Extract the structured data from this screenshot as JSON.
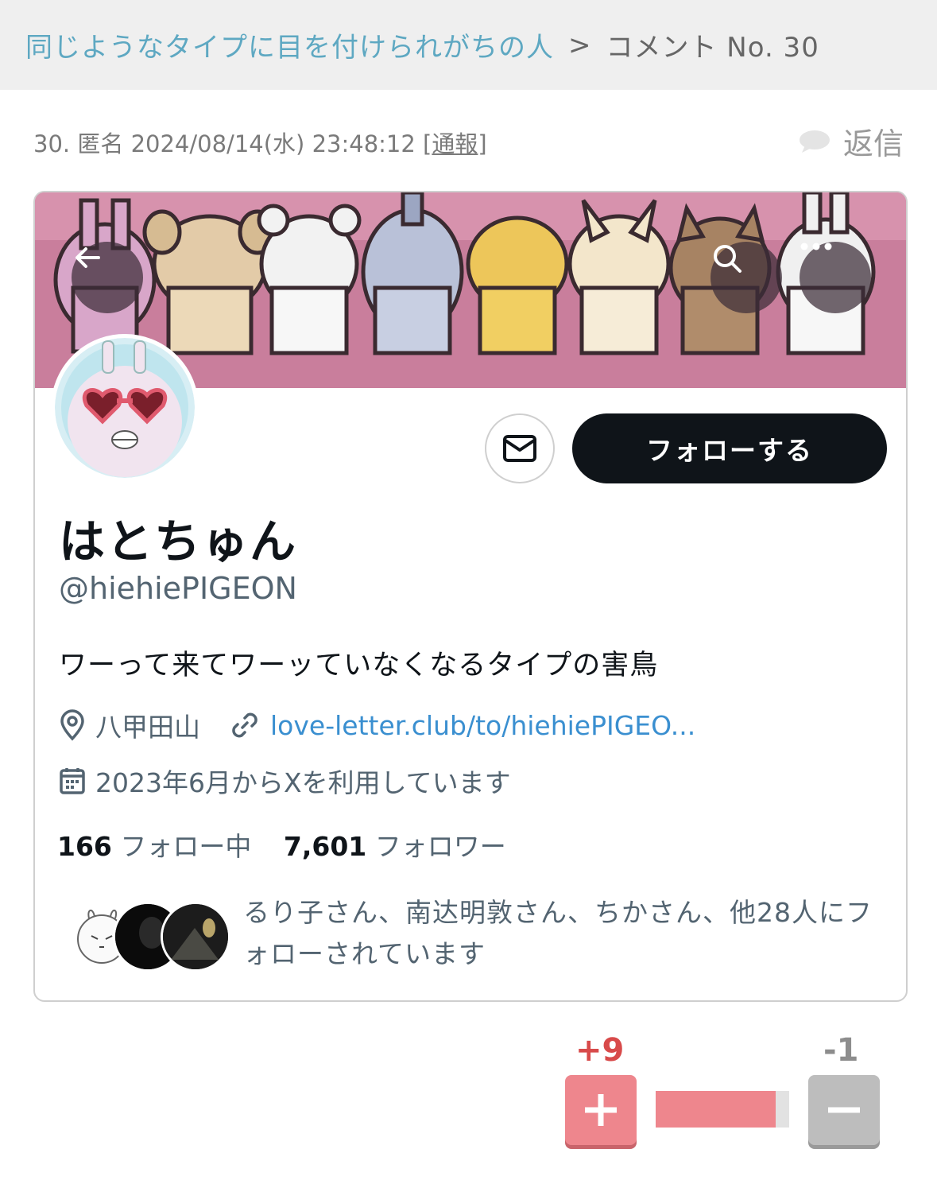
{
  "breadcrumb": {
    "parent": "同じようなタイプに目を付けられがちの人",
    "separator": ">",
    "current": "コメント No. 30"
  },
  "comment": {
    "number": "30.",
    "author": "匿名",
    "datetime": "2024/08/14(水) 23:48:12",
    "report_open": "[",
    "report_label": "通報",
    "report_close": "]",
    "reply_label": "返信"
  },
  "profile": {
    "display_name": "はとちゅん",
    "handle": "@hiehiePIGEON",
    "bio": "ワーって来てワーッていなくなるタイプの害鳥",
    "location": "八甲田山",
    "website": "love-letter.club/to/hiehiePIGEO...",
    "joined": "2023年6月からXを利用しています",
    "following_count": "166",
    "following_label": "フォロー中",
    "followers_count": "7,601",
    "followers_label": "フォロワー",
    "followed_by": "るり子さん、南达明敦さん、ちかさん、他28人にフォローされています",
    "follow_button": "フォローする"
  },
  "votes": {
    "plus": "+9",
    "minus": "-1",
    "plus_ratio": 0.9
  },
  "colors": {
    "banner": "#c97e9c",
    "link": "#5ea8c2",
    "vote_plus": "#ee868d",
    "vote_minus": "#bdbdbd"
  }
}
